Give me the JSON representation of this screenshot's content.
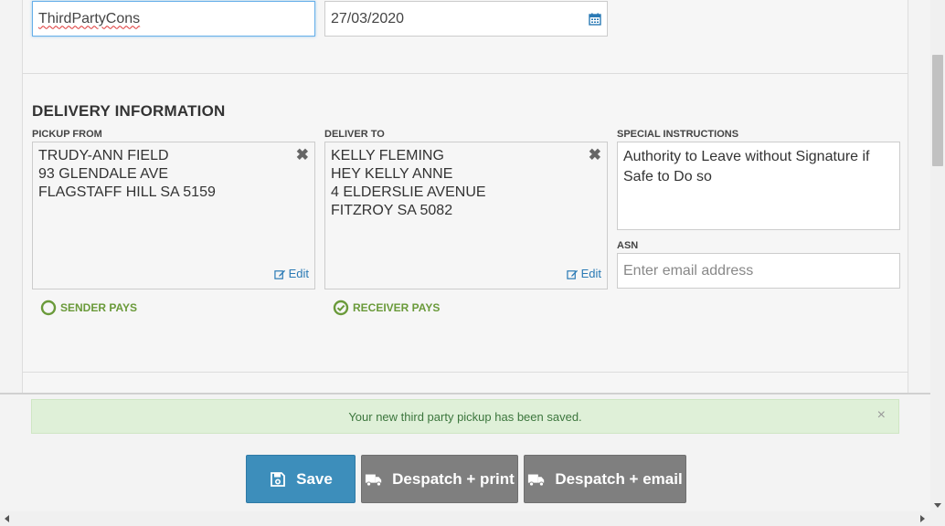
{
  "top_fields": {
    "reference_value": "ThirdPartyCons",
    "date_value": "27/03/2020"
  },
  "delivery": {
    "section_title": "DELIVERY INFORMATION",
    "pickup_label": "PICKUP FROM",
    "pickup_lines": [
      "TRUDY-ANN FIELD",
      "93 GLENDALE AVE",
      "FLAGSTAFF HILL SA 5159"
    ],
    "deliver_label": "DELIVER TO",
    "deliver_lines": [
      "KELLY FLEMING",
      "HEY KELLY ANNE",
      "4 ELDERSLIE AVENUE",
      "FITZROY SA 5082"
    ],
    "edit_label": "Edit",
    "close_glyph": "✖",
    "special_label": "SPECIAL INSTRUCTIONS",
    "special_value": "Authority to Leave without Signature if Safe to Do so",
    "asn_label": "ASN",
    "asn_placeholder": "Enter email address",
    "sender_pays_label": "SENDER PAYS",
    "receiver_pays_label": "RECEIVER PAYS",
    "selected_payer": "receiver"
  },
  "alert": {
    "message": "Your new third party pickup has been saved.",
    "close_glyph": "×"
  },
  "actions": {
    "save_label": "Save",
    "despatch_print_label": "Despatch + print",
    "despatch_email_label": "Despatch + email"
  },
  "colors": {
    "primary": "#3d8ebb",
    "secondary_button": "#7f7f7f",
    "success_bg": "#dff0d8",
    "success_text": "#3c763d",
    "payer_green": "#6a9a3a",
    "link": "#2a7ab5"
  },
  "icons": {
    "calendar": "calendar-icon",
    "edit": "edit-icon",
    "save": "floppy-disk-icon",
    "truck": "truck-icon",
    "check_circle": "check-circle-icon",
    "empty_circle": "circle-icon"
  }
}
